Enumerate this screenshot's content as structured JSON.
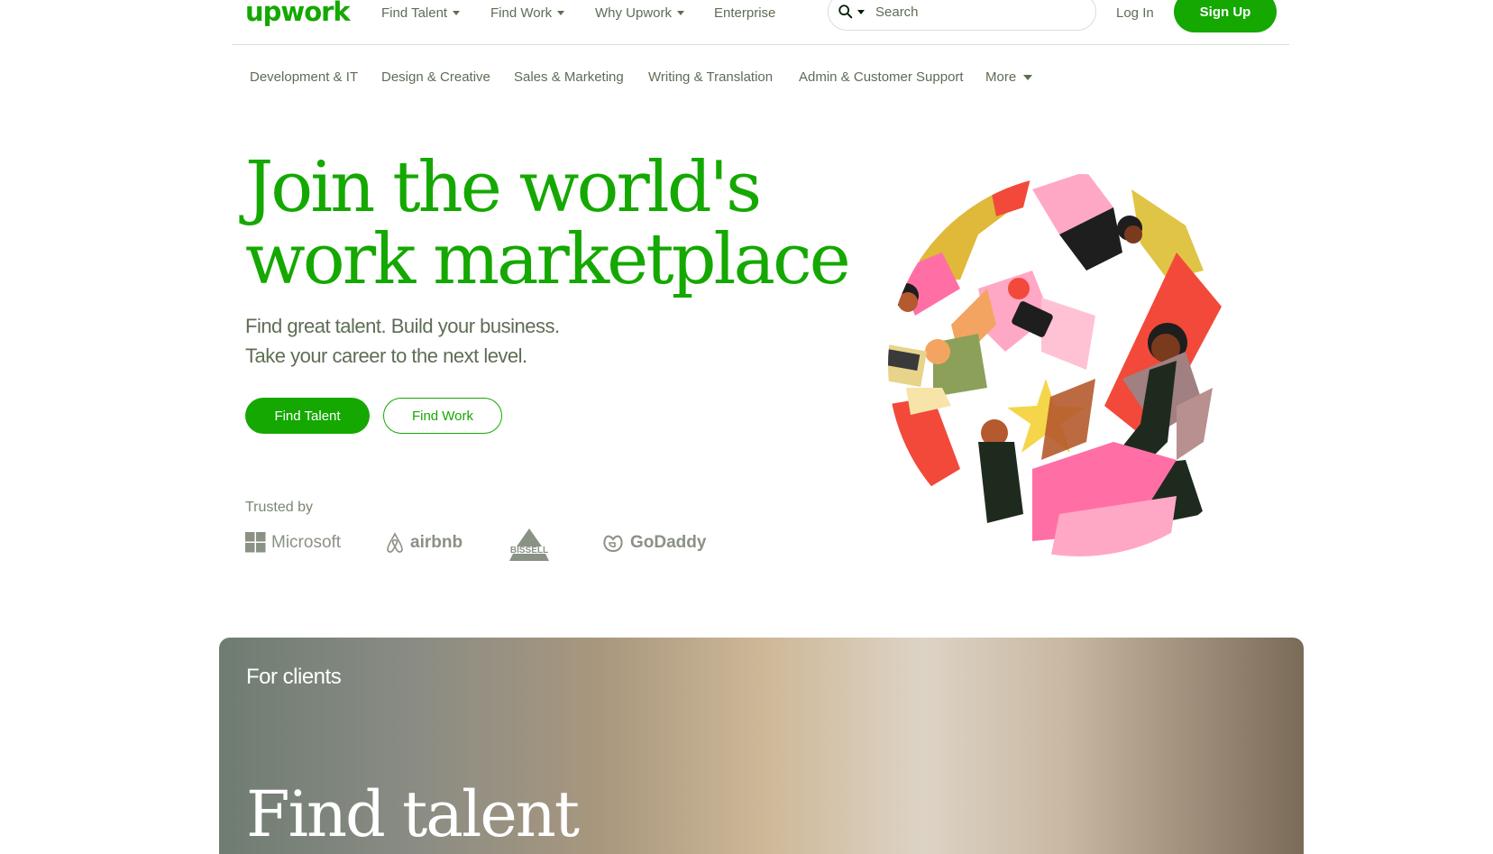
{
  "header": {
    "logo": "upwork",
    "nav": [
      {
        "label": "Find Talent"
      },
      {
        "label": "Find Work"
      },
      {
        "label": "Why Upwork"
      },
      {
        "label": "Enterprise"
      }
    ],
    "search_placeholder": "Search",
    "login": "Log In",
    "signup": "Sign Up"
  },
  "categories": [
    "Development & IT",
    "Design & Creative",
    "Sales & Marketing",
    "Writing & Translation",
    "Admin & Customer Support",
    "More"
  ],
  "hero": {
    "title_line1": "Join the world's",
    "title_line2": "work marketplace",
    "sub_line1": "Find great talent. Build your business.",
    "sub_line2": "Take your career to the next level.",
    "btn_talent": "Find Talent",
    "btn_work": "Find Work",
    "trusted_by": "Trusted by",
    "brands": [
      "Microsoft",
      "airbnb",
      "BISSELL",
      "GoDaddy"
    ]
  },
  "card": {
    "eyebrow": "For clients",
    "heading": "Find talent"
  },
  "colors": {
    "brand_green": "#14a800",
    "text_muted": "#5e6d55"
  }
}
